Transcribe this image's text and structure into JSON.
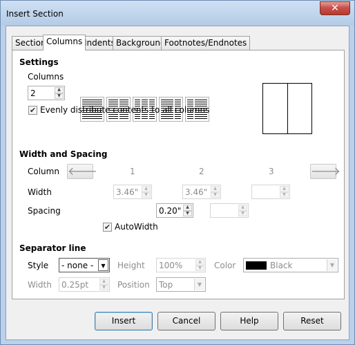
{
  "window": {
    "title": "Insert Section",
    "close_glyph": "✕"
  },
  "tabs": [
    {
      "label": "Section"
    },
    {
      "label": "Columns"
    },
    {
      "label": "Indents"
    },
    {
      "label": "Background"
    },
    {
      "label": "Footnotes/Endnotes"
    }
  ],
  "active_tab": "Columns",
  "settings": {
    "heading": "Settings",
    "columns_label": "Columns",
    "columns_value": "2",
    "evenly_label": "Evenly distribute contents to all columns",
    "evenly_checked": true,
    "check_glyph": "✔",
    "presets": [
      1,
      2,
      3,
      4,
      5
    ]
  },
  "width_spacing": {
    "heading": "Width and Spacing",
    "column_label": "Column",
    "col_numbers": [
      "1",
      "2",
      "3"
    ],
    "width_label": "Width",
    "widths": [
      "3.46\"",
      "3.46\"",
      ""
    ],
    "spacing_label": "Spacing",
    "spacings": [
      "0.20\"",
      ""
    ],
    "autowidth_label": "AutoWidth",
    "autowidth_checked": true,
    "left_arrow": "🡐",
    "right_arrow": "🡒"
  },
  "separator": {
    "heading": "Separator line",
    "style_label": "Style",
    "style_value": "- none -",
    "height_label": "Height",
    "height_value": "100%",
    "color_label": "Color",
    "color_value": "Black",
    "color_hex": "#000000",
    "width_label": "Width",
    "width_value": "0.25pt",
    "position_label": "Position",
    "position_value": "Top"
  },
  "buttons": {
    "insert": "Insert",
    "cancel": "Cancel",
    "help": "Help",
    "reset": "Reset"
  }
}
